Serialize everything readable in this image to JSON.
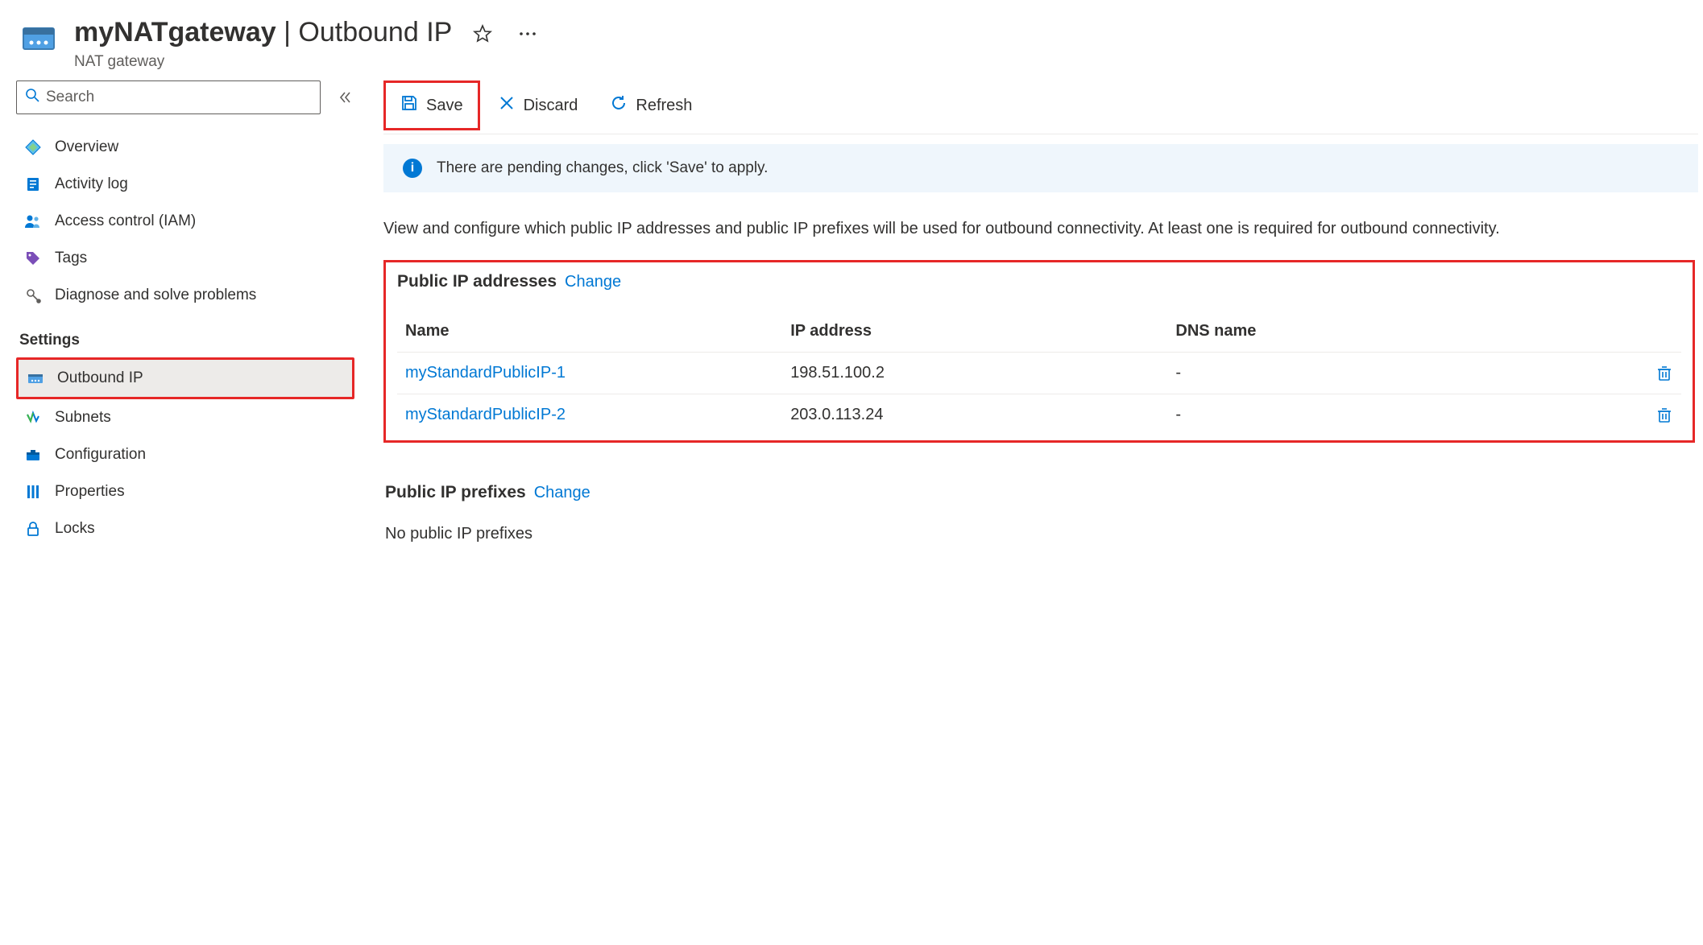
{
  "header": {
    "resource_name": "myNATgateway",
    "page_name": "Outbound IP",
    "resource_type": "NAT gateway"
  },
  "sidebar": {
    "search_placeholder": "Search",
    "items_top": [
      {
        "label": "Overview",
        "icon": "overview"
      },
      {
        "label": "Activity log",
        "icon": "activity"
      },
      {
        "label": "Access control (IAM)",
        "icon": "iam"
      },
      {
        "label": "Tags",
        "icon": "tags"
      },
      {
        "label": "Diagnose and solve problems",
        "icon": "diagnose"
      }
    ],
    "section_settings": "Settings",
    "items_settings": [
      {
        "label": "Outbound IP",
        "icon": "natgw",
        "selected": true
      },
      {
        "label": "Subnets",
        "icon": "subnets"
      },
      {
        "label": "Configuration",
        "icon": "config"
      },
      {
        "label": "Properties",
        "icon": "properties"
      },
      {
        "label": "Locks",
        "icon": "locks"
      }
    ]
  },
  "toolbar": {
    "save": "Save",
    "discard": "Discard",
    "refresh": "Refresh"
  },
  "info_message": "There are pending changes, click 'Save' to apply.",
  "description": "View and configure which public IP addresses and public IP prefixes will be used for outbound connectivity. At least one is required for outbound connectivity.",
  "public_ip": {
    "title": "Public IP addresses",
    "change": "Change",
    "columns": {
      "name": "Name",
      "ip": "IP address",
      "dns": "DNS name"
    },
    "rows": [
      {
        "name": "myStandardPublicIP-1",
        "ip": "198.51.100.2",
        "dns": "-"
      },
      {
        "name": "myStandardPublicIP-2",
        "ip": "203.0.113.24",
        "dns": "-"
      }
    ]
  },
  "public_ip_prefixes": {
    "title": "Public IP prefixes",
    "change": "Change",
    "empty": "No public IP prefixes"
  }
}
